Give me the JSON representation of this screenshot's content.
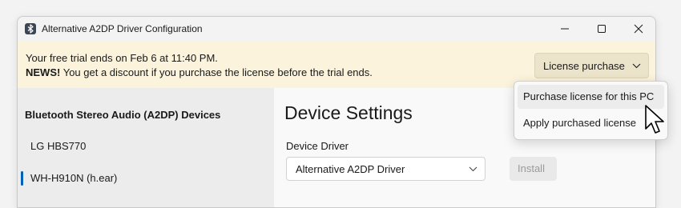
{
  "window": {
    "title": "Alternative A2DP Driver Configuration",
    "app_icon": "bluetooth-icon",
    "controls": [
      "minimize-icon",
      "maximize-icon",
      "close-icon"
    ]
  },
  "banner": {
    "trial_text": "Your free trial ends on Feb  6 at 11:40 PM.",
    "news_label": "NEWS!",
    "news_text": " You get a discount if you purchase the license before the trial ends.",
    "license_button_label": "License purchase",
    "license_button_icon": "chevron-down-icon"
  },
  "sidebar": {
    "heading": "Bluetooth Stereo Audio (A2DP) Devices",
    "devices": [
      {
        "label": "LG HBS770",
        "selected": false
      },
      {
        "label": "WH-H910N (h.ear)",
        "selected": true
      }
    ]
  },
  "main": {
    "title": "Device Settings",
    "driver_label": "Device Driver",
    "driver_value": "Alternative A2DP Driver",
    "install_label": "Install"
  },
  "license_menu": {
    "items": [
      {
        "label": "Purchase license for this PC",
        "hovered": true
      },
      {
        "label": "Apply purchased license",
        "hovered": false
      }
    ]
  },
  "colors": {
    "banner_bg": "#fbf3db",
    "accent": "#005fb8",
    "sidebar_bg": "#ececec"
  }
}
